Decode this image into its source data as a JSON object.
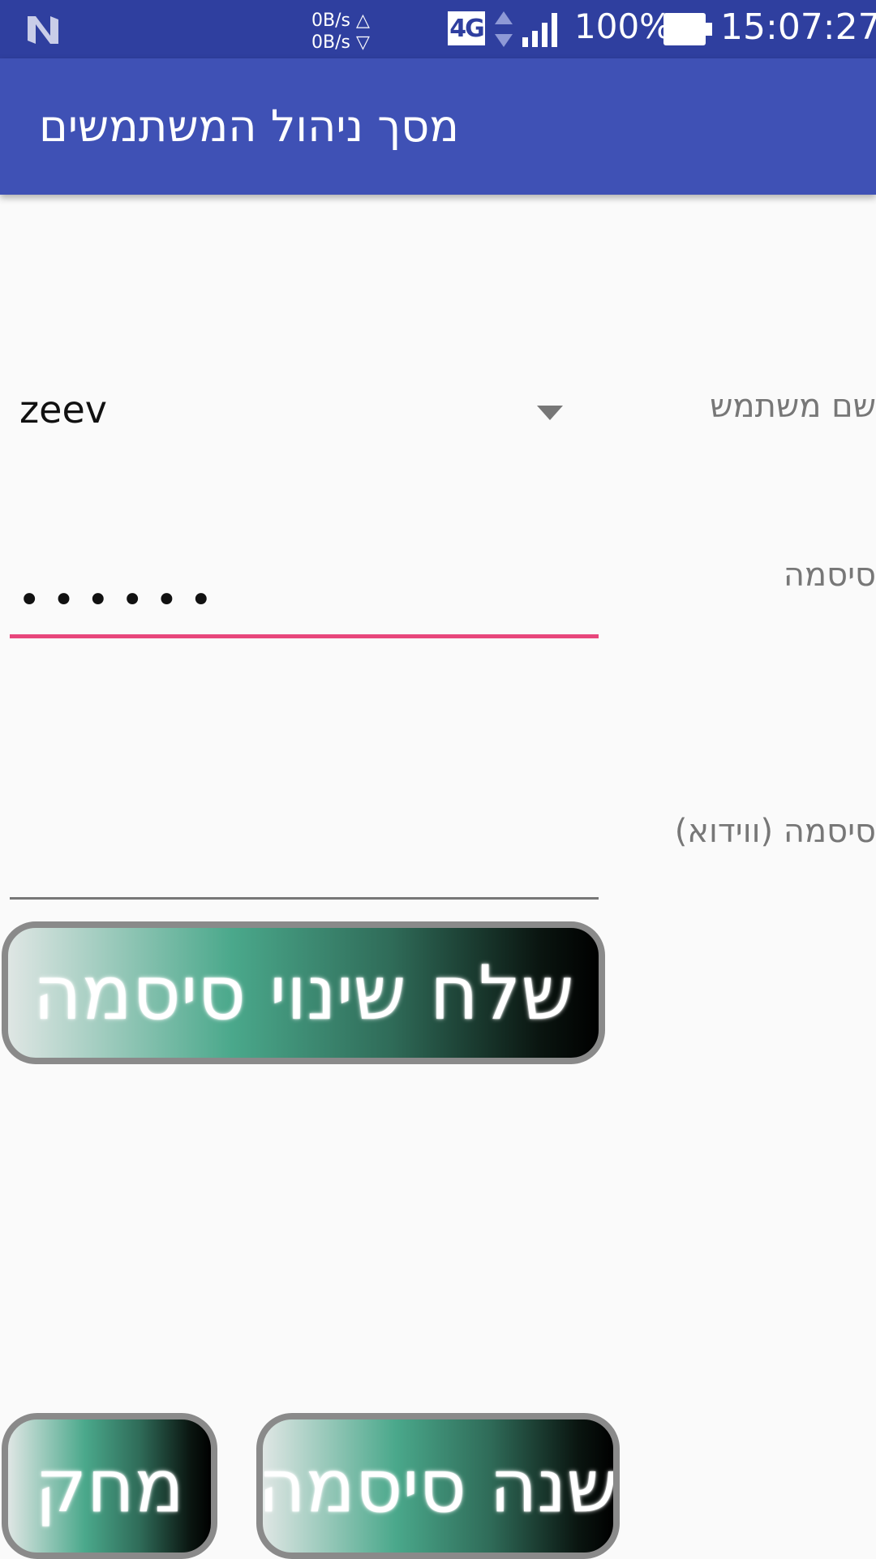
{
  "status_bar": {
    "net_up": "0B/s △",
    "net_down": "0B/s ▽",
    "network_type": "4G",
    "battery_percent": "100%",
    "time": "15:07:27"
  },
  "app_bar": {
    "title": "מסך ניהול המשתמשים"
  },
  "form": {
    "username_label": "שם משתמש",
    "username_value": "zeev",
    "password_label": "סיסמה",
    "password_value": "••••••",
    "confirm_label": "סיסמה (ווידוא)",
    "confirm_value": ""
  },
  "buttons": {
    "send_change": "שלח שינוי סיסמה",
    "change_password": "שנה סיסמה",
    "delete": "מחק"
  },
  "colors": {
    "status_bar": "#2f3f9f",
    "app_bar": "#3f51b5",
    "accent": "#e8467c"
  }
}
